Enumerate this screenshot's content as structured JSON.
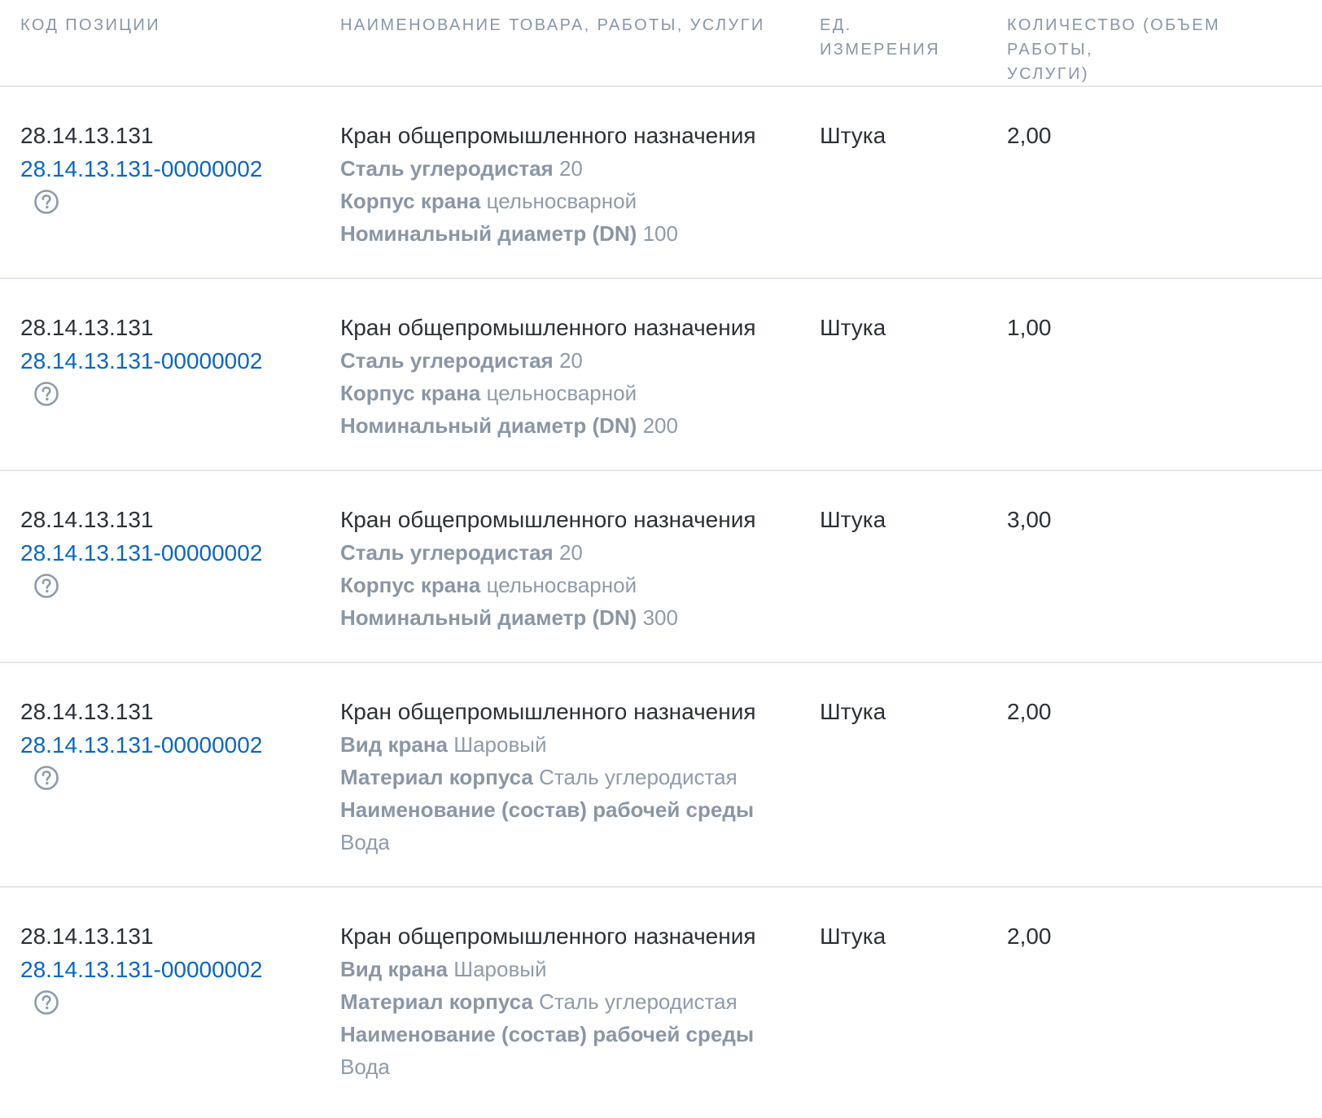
{
  "columns": {
    "code": "Код позиции",
    "name": "Наименование товара, работы, услуги",
    "unit_line1": "Ед.",
    "unit_line2": "измерения",
    "qty_line1": "Количество (объем работы,",
    "qty_line2": "услуги)"
  },
  "icons": {
    "help": "question-circle-icon"
  },
  "colors": {
    "link": "#0a66c8",
    "muted": "#8f9bab",
    "text": "#2b3136",
    "divider": "#e3e7ee"
  },
  "rows": [
    {
      "okpd": "28.14.13.131",
      "ktru": "28.14.13.131-00000002",
      "name": "Кран общепромышленного назначения",
      "attrs": [
        {
          "label": "Сталь углеродистая",
          "value": "20"
        },
        {
          "label": "Корпус крана",
          "value": "цельносварной"
        },
        {
          "label": "Номинальный диаметр (DN)",
          "value": "100"
        }
      ],
      "unit": "Штука",
      "qty": "2,00"
    },
    {
      "okpd": "28.14.13.131",
      "ktru": "28.14.13.131-00000002",
      "name": "Кран общепромышленного назначения",
      "attrs": [
        {
          "label": "Сталь углеродистая",
          "value": "20"
        },
        {
          "label": "Корпус крана",
          "value": "цельносварной"
        },
        {
          "label": "Номинальный диаметр (DN)",
          "value": "200"
        }
      ],
      "unit": "Штука",
      "qty": "1,00"
    },
    {
      "okpd": "28.14.13.131",
      "ktru": "28.14.13.131-00000002",
      "name": "Кран общепромышленного назначения",
      "attrs": [
        {
          "label": "Сталь углеродистая",
          "value": "20"
        },
        {
          "label": "Корпус крана",
          "value": "цельносварной"
        },
        {
          "label": "Номинальный диаметр (DN)",
          "value": "300"
        }
      ],
      "unit": "Штука",
      "qty": "3,00"
    },
    {
      "okpd": "28.14.13.131",
      "ktru": "28.14.13.131-00000002",
      "name": "Кран общепромышленного назначения",
      "attrs": [
        {
          "label": "Вид крана",
          "value": "Шаровый"
        },
        {
          "label": "Материал корпуса",
          "value": "Сталь углеродистая"
        },
        {
          "label": "Наименование (состав) рабочей среды",
          "value": "Вода"
        }
      ],
      "unit": "Штука",
      "qty": "2,00"
    },
    {
      "okpd": "28.14.13.131",
      "ktru": "28.14.13.131-00000002",
      "name": "Кран общепромышленного назначения",
      "attrs": [
        {
          "label": "Вид крана",
          "value": "Шаровый"
        },
        {
          "label": "Материал корпуса",
          "value": "Сталь углеродистая"
        },
        {
          "label": "Наименование (состав) рабочей среды",
          "value": "Вода"
        }
      ],
      "unit": "Штука",
      "qty": "2,00"
    }
  ]
}
